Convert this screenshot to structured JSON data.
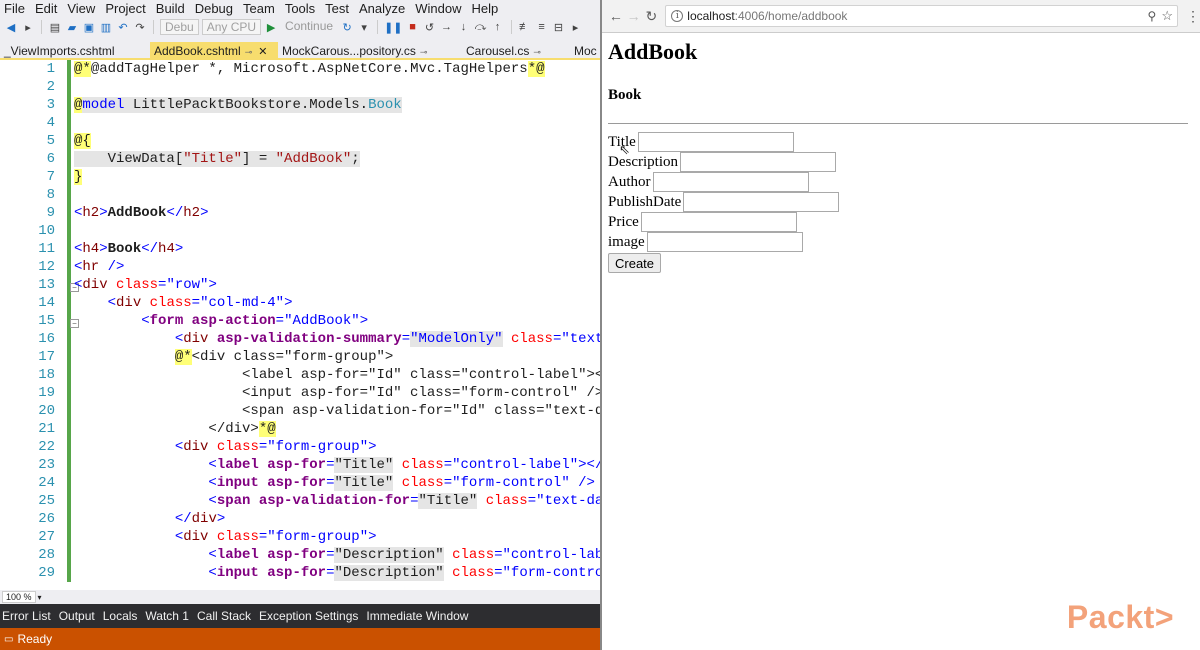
{
  "vs": {
    "menu": [
      "File",
      "Edit",
      "View",
      "Project",
      "Build",
      "Debug",
      "Team",
      "Tools",
      "Test",
      "Analyze",
      "Window",
      "Help"
    ],
    "toolbar": {
      "config": "Debu",
      "platform": "Any CPU",
      "continue": "Continue"
    },
    "tabs": [
      {
        "label": "_ViewImports.cshtml",
        "active": false
      },
      {
        "label": "AddBook.cshtml",
        "active": true
      },
      {
        "label": "MockCarous...pository.cs",
        "active": false
      },
      {
        "label": "Carousel.cs",
        "active": false
      },
      {
        "label": "Moc",
        "active": false
      }
    ],
    "lines": [
      "1",
      "2",
      "3",
      "4",
      "5",
      "6",
      "7",
      "8",
      "9",
      "10",
      "11",
      "12",
      "13",
      "14",
      "15",
      "16",
      "17",
      "18",
      "19",
      "20",
      "21",
      "22",
      "23",
      "24",
      "25",
      "26",
      "27",
      "28",
      "29"
    ],
    "zoom": "100 %",
    "bottom_tabs": [
      "Error List",
      "Output",
      "Locals",
      "Watch 1",
      "Call Stack",
      "Exception Settings",
      "Immediate Window"
    ],
    "status": "Ready"
  },
  "browser": {
    "url_host": "localhost",
    "url_path": ":4006/home/addbook",
    "page": {
      "title": "AddBook",
      "subtitle": "Book",
      "fields": [
        "Title",
        "Description",
        "Author",
        "PublishDate",
        "Price",
        "image"
      ],
      "submit": "Create"
    }
  },
  "watermark": "Packt>"
}
